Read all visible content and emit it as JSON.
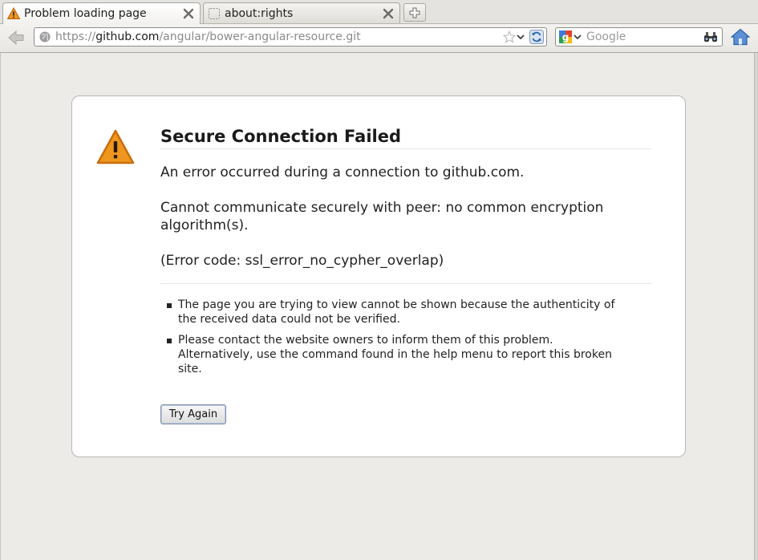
{
  "tabs": [
    {
      "label": "Problem loading page",
      "icon": "warning-icon",
      "active": true
    },
    {
      "label": "about:rights",
      "icon": "blank-page-icon",
      "active": false
    }
  ],
  "navbar": {
    "url_scheme": "https://",
    "url_host": "github.com",
    "url_path": "/angular/bower-angular-resource.git",
    "search_placeholder": "Google"
  },
  "error": {
    "title": "Secure Connection Failed",
    "short_desc": [
      "An error occurred during a connection to github.com.",
      "Cannot communicate securely with peer: no common encryption algorithm(s).",
      "(Error code: ssl_error_no_cypher_overlap)"
    ],
    "long_desc": [
      "The page you are trying to view cannot be shown because the authenticity of the received data could not be verified.",
      "Please contact the website owners to inform them of this problem. Alternatively, use the command found in the help menu to report this broken site."
    ],
    "try_again_label": "Try Again"
  },
  "colors": {
    "warning_orange": "#f0961e",
    "page_background": "#ecebe8",
    "box_background": "#ffffff"
  }
}
